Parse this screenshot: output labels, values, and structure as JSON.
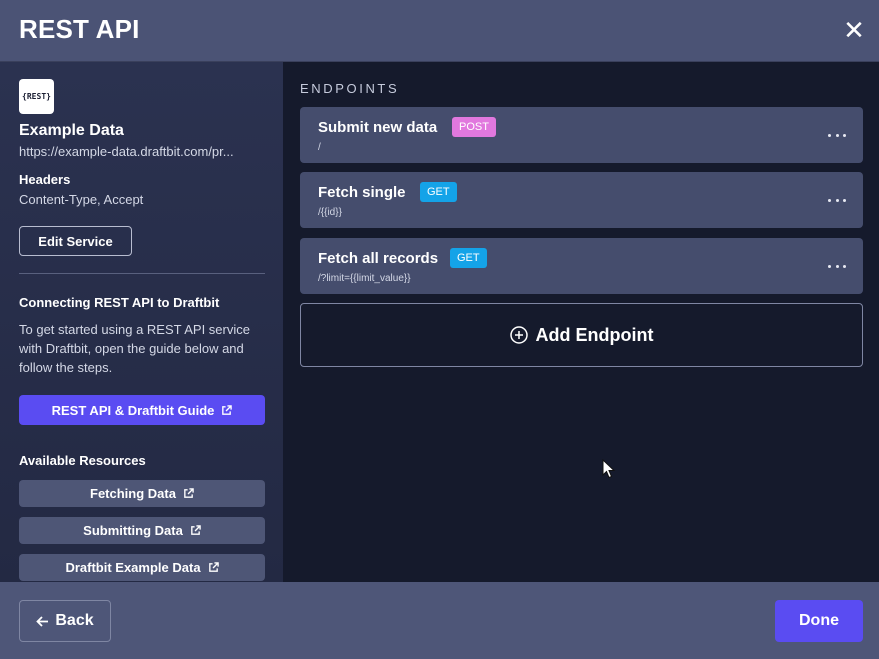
{
  "window": {
    "title": "REST API",
    "close_label": "✕"
  },
  "service": {
    "logo_text": "{REST}",
    "name": "Example Data",
    "url": "https://example-data.draftbit.com/pr...",
    "headers_label": "Headers",
    "headers_value": "Content-Type, Accept",
    "edit_label": "Edit Service"
  },
  "connecting": {
    "title": "Connecting REST API to Draftbit",
    "text": "To get started using a REST API service with Draftbit, open the guide below and follow the steps.",
    "guide_label": "REST API & Draftbit Guide"
  },
  "resources": {
    "title": "Available Resources",
    "items": [
      {
        "label": "Fetching Data"
      },
      {
        "label": "Submitting Data"
      },
      {
        "label": "Draftbit Example Data"
      }
    ]
  },
  "endpoints": {
    "title": "ENDPOINTS",
    "items": [
      {
        "name": "Submit new data",
        "method": "POST",
        "path": "/"
      },
      {
        "name": "Fetch single",
        "method": "GET",
        "path": "/{{id}}"
      },
      {
        "name": "Fetch all records",
        "method": "GET",
        "path": "/?limit={{limit_value}}"
      }
    ],
    "add_label": "Add Endpoint"
  },
  "footer": {
    "back_label": "Back",
    "done_label": "Done"
  },
  "colors": {
    "primary": "#5a4cf2",
    "post_badge": "#e178de",
    "get_badge": "#14a3e8"
  }
}
